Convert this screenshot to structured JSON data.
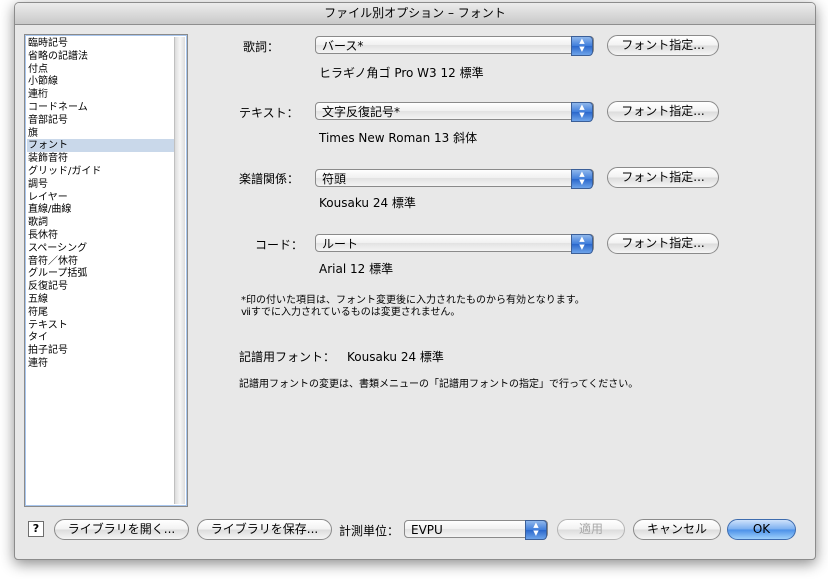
{
  "window": {
    "title": "ファイル別オプション – フォント"
  },
  "sidebar": {
    "items": [
      {
        "label": "臨時記号"
      },
      {
        "label": "省略の記譜法"
      },
      {
        "label": "付点"
      },
      {
        "label": "小節線"
      },
      {
        "label": "連桁"
      },
      {
        "label": "コードネーム"
      },
      {
        "label": "音部記号"
      },
      {
        "label": "旗"
      },
      {
        "label": "フォント"
      },
      {
        "label": "装飾音符"
      },
      {
        "label": "グリッド/ガイド"
      },
      {
        "label": "調号"
      },
      {
        "label": "レイヤー"
      },
      {
        "label": "直線/曲線"
      },
      {
        "label": "歌詞"
      },
      {
        "label": "長休符"
      },
      {
        "label": "スペーシング"
      },
      {
        "label": "音符／休符"
      },
      {
        "label": "グループ括弧"
      },
      {
        "label": "反復記号"
      },
      {
        "label": "五線"
      },
      {
        "label": "符尾"
      },
      {
        "label": "テキスト"
      },
      {
        "label": "タイ"
      },
      {
        "label": "拍子記号"
      },
      {
        "label": "連符"
      }
    ],
    "selected": "フォント"
  },
  "rows": [
    {
      "label": "歌詞：",
      "value": "バース*",
      "button": "フォント指定...",
      "font_info": "ヒラギノ角ゴ Pro W3 12 標準"
    },
    {
      "label": "テキスト：",
      "value": "文字反復記号*",
      "button": "フォント指定...",
      "font_info": "Times New Roman 13 斜体"
    },
    {
      "label": "楽譜関係：",
      "value": "符頭",
      "button": "フォント指定...",
      "font_info": "Kousaku 24 標準"
    },
    {
      "label": "コード：",
      "value": "ルート",
      "button": "フォント指定...",
      "font_info": "Arial 12 標準"
    }
  ],
  "notes": {
    "line1": "*印の付いた項目は、フォント変更後に入力されたものから有効となります。",
    "line2": "ⅶすでに入力されているものは変更されません。"
  },
  "notation_font": {
    "label": "記譜用フォント：",
    "value": "Kousaku 24 標準"
  },
  "notation_note": "記譜用フォントの変更は、書類メニューの「記譜用フォントの指定」で行ってください。",
  "footer": {
    "help": "?",
    "open_library": "ライブラリを開く...",
    "save_library": "ライブラリを保存...",
    "units_label": "計測単位：",
    "units_value": "EVPU",
    "apply": "適用",
    "cancel": "キャンセル",
    "ok": "OK"
  },
  "colors": {
    "accent": "#4a90e8",
    "selection": "#c9d8ea"
  }
}
